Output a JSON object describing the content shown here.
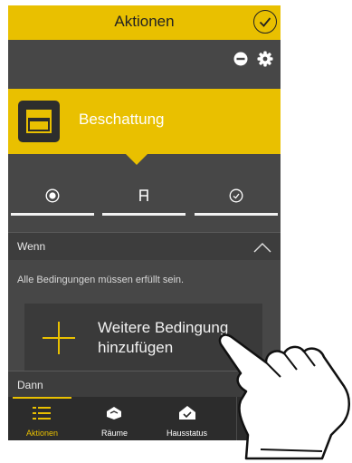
{
  "header": {
    "title": "Aktionen"
  },
  "banner": {
    "name": "Beschattung"
  },
  "tabs": [
    {
      "icon": "target-icon"
    },
    {
      "icon": "letter-a-icon"
    },
    {
      "icon": "clock-icon"
    }
  ],
  "conditions": {
    "heading": "Wenn",
    "hint": "Alle Bedingungen müssen erfüllt sein.",
    "add_label": "Weitere Bedingung hinzufügen"
  },
  "then": {
    "heading": "Dann"
  },
  "bottom_nav": [
    {
      "label": "Aktionen",
      "icon": "list-icon",
      "active": true
    },
    {
      "label": "Räume",
      "icon": "room-icon",
      "active": false
    },
    {
      "label": "Hausstatus",
      "icon": "house-status-icon",
      "active": false
    }
  ],
  "colors": {
    "accent": "#e9c000",
    "background": "#474747"
  }
}
